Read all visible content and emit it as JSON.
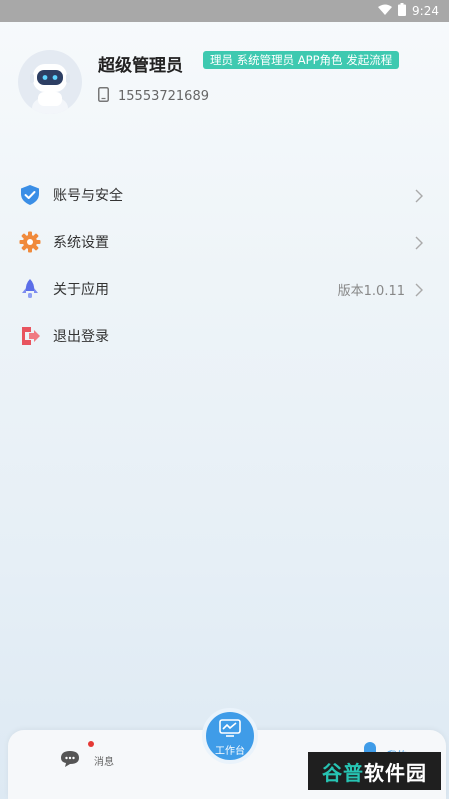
{
  "status_bar": {
    "time": "9:24",
    "wifi_icon": "wifi-icon",
    "battery_icon": "battery-icon"
  },
  "profile": {
    "avatar_icon": "robot-avatar",
    "name": "超级管理员",
    "roles": "理员 系统管理员 APP角色 发起流程",
    "phone": "15553721689",
    "phone_icon": "phone-icon",
    "badge_color": "#3ec9b0"
  },
  "menu": [
    {
      "label": "账号与安全",
      "icon": "shield-icon",
      "value": ""
    },
    {
      "label": "系统设置",
      "icon": "gear-icon",
      "value": ""
    },
    {
      "label": "关于应用",
      "icon": "rocket-icon",
      "value": "版本1.0.11"
    },
    {
      "label": "退出登录",
      "icon": "logout-icon",
      "value": ""
    }
  ],
  "bottom_nav": {
    "messages_label": "消息",
    "workbench_label": "工作台",
    "mine_label": "我的",
    "accent": "#3f9ce8"
  },
  "watermark": {
    "part1": "谷普",
    "part2": "软件园"
  }
}
